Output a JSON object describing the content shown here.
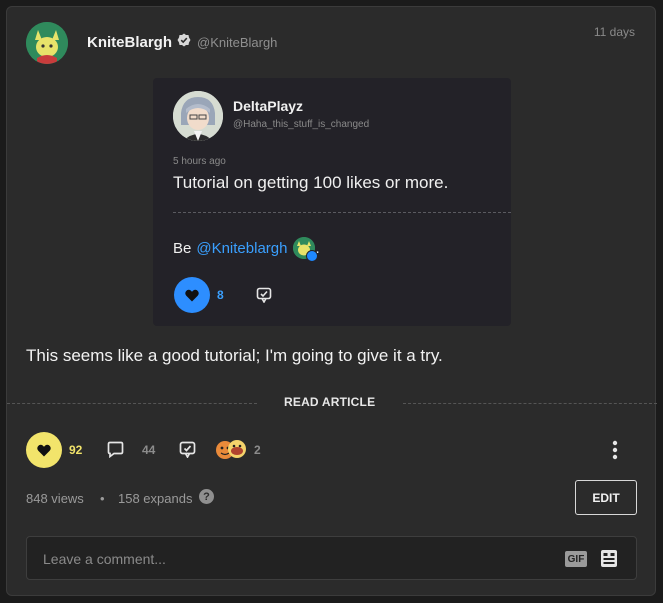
{
  "author": {
    "name": "KniteBlargh",
    "handle": "@KniteBlargh",
    "time": "11 days"
  },
  "embed": {
    "author_name": "DeltaPlayz",
    "author_handle": "@Haha_this_stuff_is_changed",
    "time": "5 hours ago",
    "title": "Tutorial on getting 100 likes or more.",
    "body_prefix": "Be",
    "mention": "@Kniteblargh",
    "body_suffix": ".",
    "like_count": "8"
  },
  "comment_text": "This seems like a good tutorial; I'm going to give it a try.",
  "read_article_label": "READ ARTICLE",
  "actions": {
    "like_count": "92",
    "comment_count": "44",
    "reaction_count": "2"
  },
  "stats": {
    "views": "848 views",
    "separator": "•",
    "expands": "158 expands"
  },
  "edit_label": "EDIT",
  "comment_input": {
    "placeholder": "Leave a comment...",
    "gif_label": "GIF"
  },
  "colors": {
    "card_bg": "#2b2b2b",
    "like_yellow": "#f2e46b",
    "embed_like_blue": "#2d8eff",
    "mention_blue": "#3aa0ff"
  }
}
